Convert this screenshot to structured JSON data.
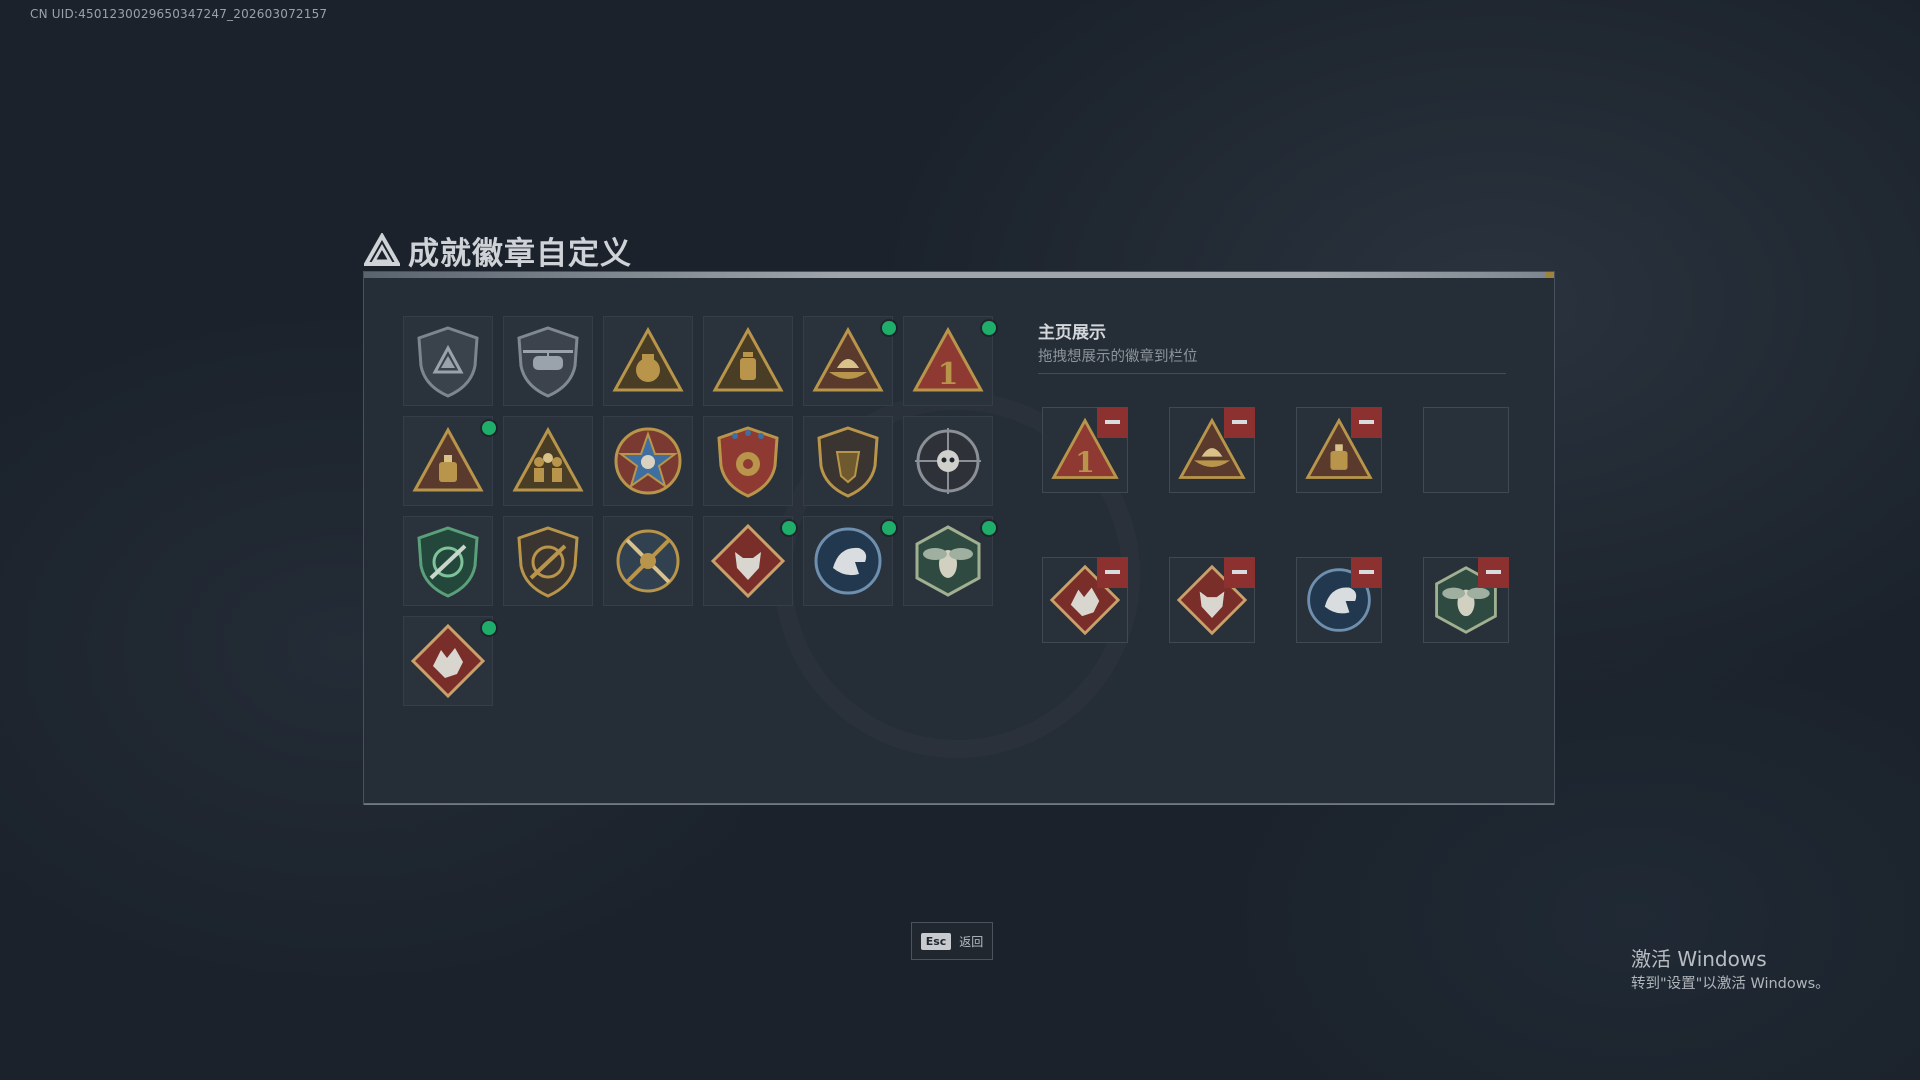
{
  "uid_label": "CN UID:4501230029650347247_202603072157",
  "title": "成就徽章自定义",
  "colors": {
    "indicator": "#1fae6a",
    "remove": "#8c3030",
    "gold": "#b8954a"
  },
  "grid": [
    {
      "icon": "shield-triangle-badge",
      "new": false
    },
    {
      "icon": "helicopter-badge",
      "new": false
    },
    {
      "icon": "money-bag-badge",
      "new": false
    },
    {
      "icon": "lantern-badge",
      "new": false
    },
    {
      "icon": "boat-badge",
      "new": true
    },
    {
      "icon": "number-one-badge",
      "number": "1",
      "new": true
    },
    {
      "icon": "bag-badge",
      "new": true
    },
    {
      "icon": "soldiers-badge",
      "new": false
    },
    {
      "icon": "star-skull-badge",
      "new": false
    },
    {
      "icon": "eagle-shield-badge",
      "new": false
    },
    {
      "icon": "lion-shield-badge",
      "new": false
    },
    {
      "icon": "skull-crosshair-badge",
      "new": false
    },
    {
      "icon": "green-rifle-shield-badge",
      "new": false
    },
    {
      "icon": "rifle-badge",
      "new": false
    },
    {
      "icon": "anchor-rifle-badge",
      "new": false
    },
    {
      "icon": "red-wolf-badge",
      "new": true
    },
    {
      "icon": "blue-eagle-badge",
      "new": true
    },
    {
      "icon": "green-hornet-badge",
      "new": true
    },
    {
      "icon": "red-dragon-badge",
      "new": true
    }
  ],
  "showcase": {
    "title": "主页展示",
    "subtitle": "拖拽想展示的徽章到栏位",
    "slots": [
      {
        "icon": "number-one-badge",
        "number": "1",
        "filled": true
      },
      {
        "icon": "boat-badge",
        "filled": true
      },
      {
        "icon": "bag-badge",
        "filled": true
      },
      {
        "icon": "empty-slot",
        "filled": false
      },
      {
        "icon": "red-dragon-badge",
        "filled": true
      },
      {
        "icon": "red-wolf-badge",
        "filled": true
      },
      {
        "icon": "blue-eagle-badge",
        "filled": true
      },
      {
        "icon": "green-hornet-badge",
        "filled": true
      }
    ]
  },
  "esc": {
    "key": "Esc",
    "label": "返回"
  },
  "windows_notice": {
    "title": "激活 Windows",
    "subtitle": "转到\"设置\"以激活 Windows。"
  }
}
